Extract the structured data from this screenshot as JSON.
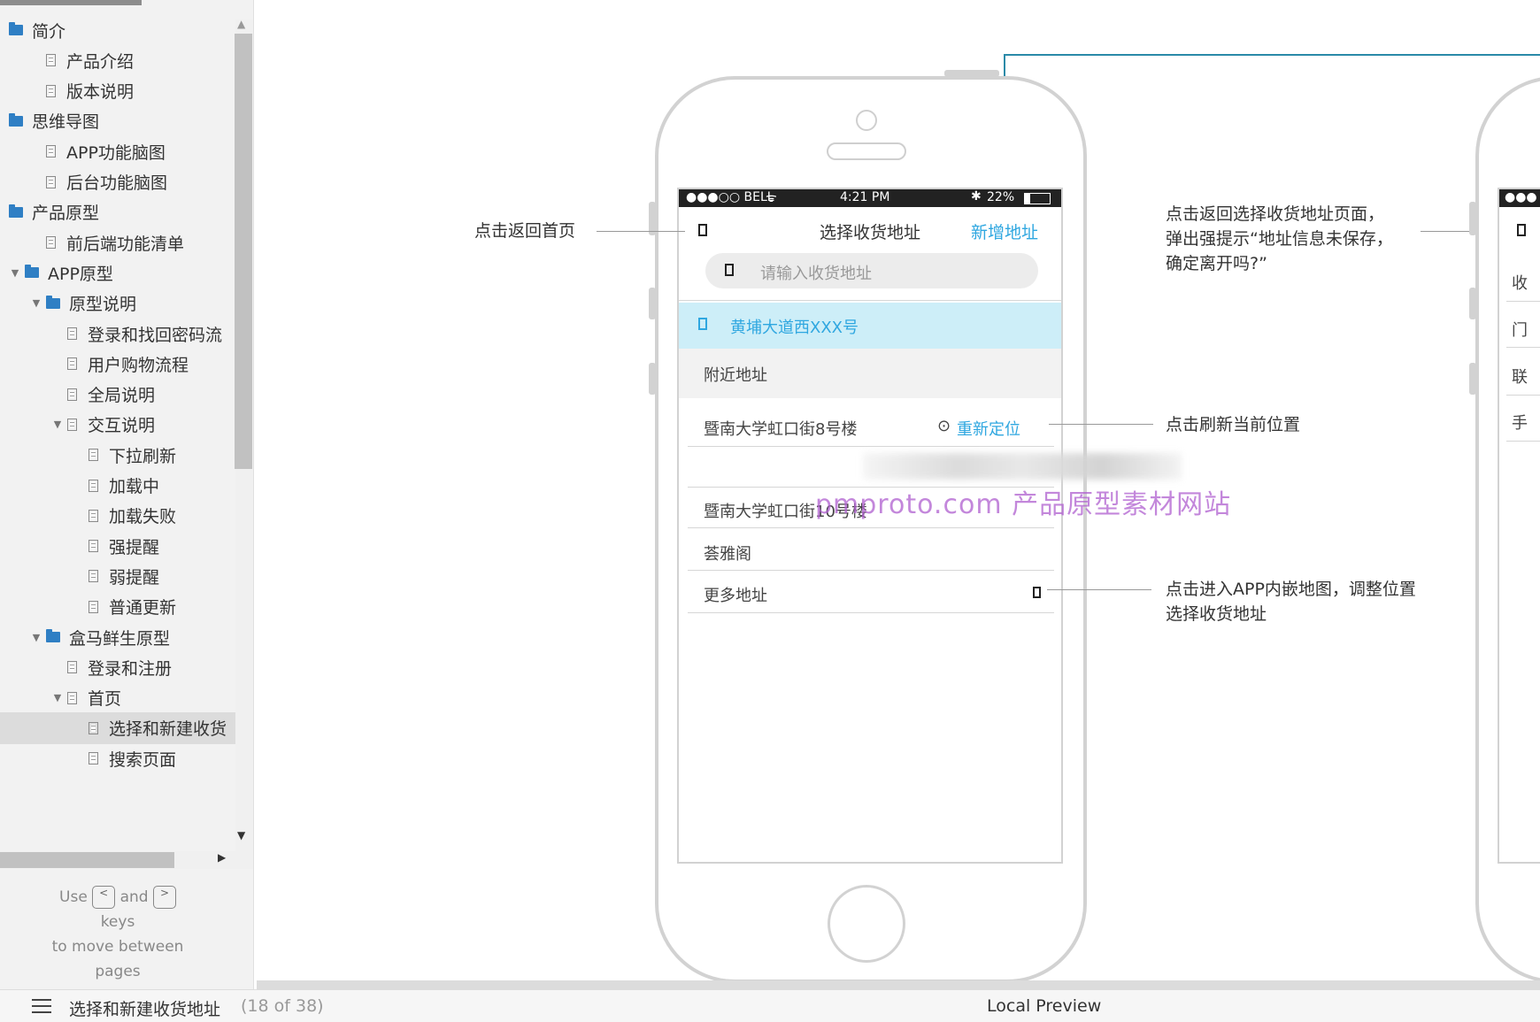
{
  "sidebar": {
    "items": [
      {
        "label": "简介",
        "type": "folder",
        "level": 0
      },
      {
        "label": "产品介绍",
        "type": "page",
        "level": 1
      },
      {
        "label": "版本说明",
        "type": "page",
        "level": 1
      },
      {
        "label": "思维导图",
        "type": "folder",
        "level": 0
      },
      {
        "label": "APP功能脑图",
        "type": "page",
        "level": 1
      },
      {
        "label": "后台功能脑图",
        "type": "page",
        "level": 1
      },
      {
        "label": "产品原型",
        "type": "folder",
        "level": 0
      },
      {
        "label": "前后端功能清单",
        "type": "page",
        "level": 1
      },
      {
        "label": "APP原型",
        "type": "folder",
        "level": 0,
        "expanded": true
      },
      {
        "label": "原型说明",
        "type": "folder",
        "level": 1,
        "expanded": true
      },
      {
        "label": "登录和找回密码流",
        "type": "page",
        "level": 2
      },
      {
        "label": "用户购物流程",
        "type": "page",
        "level": 2
      },
      {
        "label": "全局说明",
        "type": "page",
        "level": 2
      },
      {
        "label": "交互说明",
        "type": "page",
        "level": 2,
        "expanded": true
      },
      {
        "label": "下拉刷新",
        "type": "page",
        "level": 3
      },
      {
        "label": "加载中",
        "type": "page",
        "level": 3
      },
      {
        "label": "加载失败",
        "type": "page",
        "level": 3
      },
      {
        "label": "强提醒",
        "type": "page",
        "level": 3
      },
      {
        "label": "弱提醒",
        "type": "page",
        "level": 3
      },
      {
        "label": "普通更新",
        "type": "page",
        "level": 3
      },
      {
        "label": "盒马鲜生原型",
        "type": "folder",
        "level": 1,
        "expanded": true
      },
      {
        "label": "登录和注册",
        "type": "page",
        "level": 2
      },
      {
        "label": "首页",
        "type": "page",
        "level": 2,
        "expanded": true
      },
      {
        "label": "选择和新建收货",
        "type": "page",
        "level": 3,
        "selected": true
      },
      {
        "label": "搜索页面",
        "type": "page",
        "level": 3
      }
    ],
    "help": {
      "use": "Use",
      "and": "and",
      "keys": "keys",
      "line3": "to move between",
      "line4": "pages",
      "key_prev": "<",
      "key_next": ">"
    }
  },
  "statusbar": {
    "current_page": "选择和新建收货地址",
    "page_count": "(18 of 38)",
    "local_preview": "Local Preview"
  },
  "phone": {
    "status": {
      "signal": "●●●○○ BELL",
      "time": "4:21 PM",
      "battery": "22%"
    },
    "nav": {
      "title": "选择收货地址",
      "action": "新增地址"
    },
    "search_placeholder": "请输入收货地址",
    "current_address": "黄埔大道西XXX号",
    "section_title": "附近地址",
    "nearby": [
      {
        "label": "暨南大学虹口街8号楼",
        "relocate": "重新定位"
      },
      {
        "label": "暨南大学虹口街10号楼"
      },
      {
        "label": "荟雅阁"
      },
      {
        "label": "更多地址"
      }
    ]
  },
  "annotations": {
    "back_home": "点击返回首页",
    "back_confirm": [
      "点击返回选择收货地址页面，",
      "弹出强提示“地址信息未保存，",
      "确定离开吗?”"
    ],
    "refresh": "点击刷新当前位置",
    "map": [
      "点击进入APP内嵌地图，调整位置",
      "选择收货地址"
    ]
  },
  "second_phone": {
    "rows": [
      "收",
      "门",
      "联",
      "手"
    ]
  },
  "watermark": "pmproto.com 产品原型素材网站",
  "colors": {
    "accent": "#2fa7e0",
    "highlight": "#cdeef8",
    "folder": "#2f7fc4",
    "connector": "#2a8aa8"
  }
}
